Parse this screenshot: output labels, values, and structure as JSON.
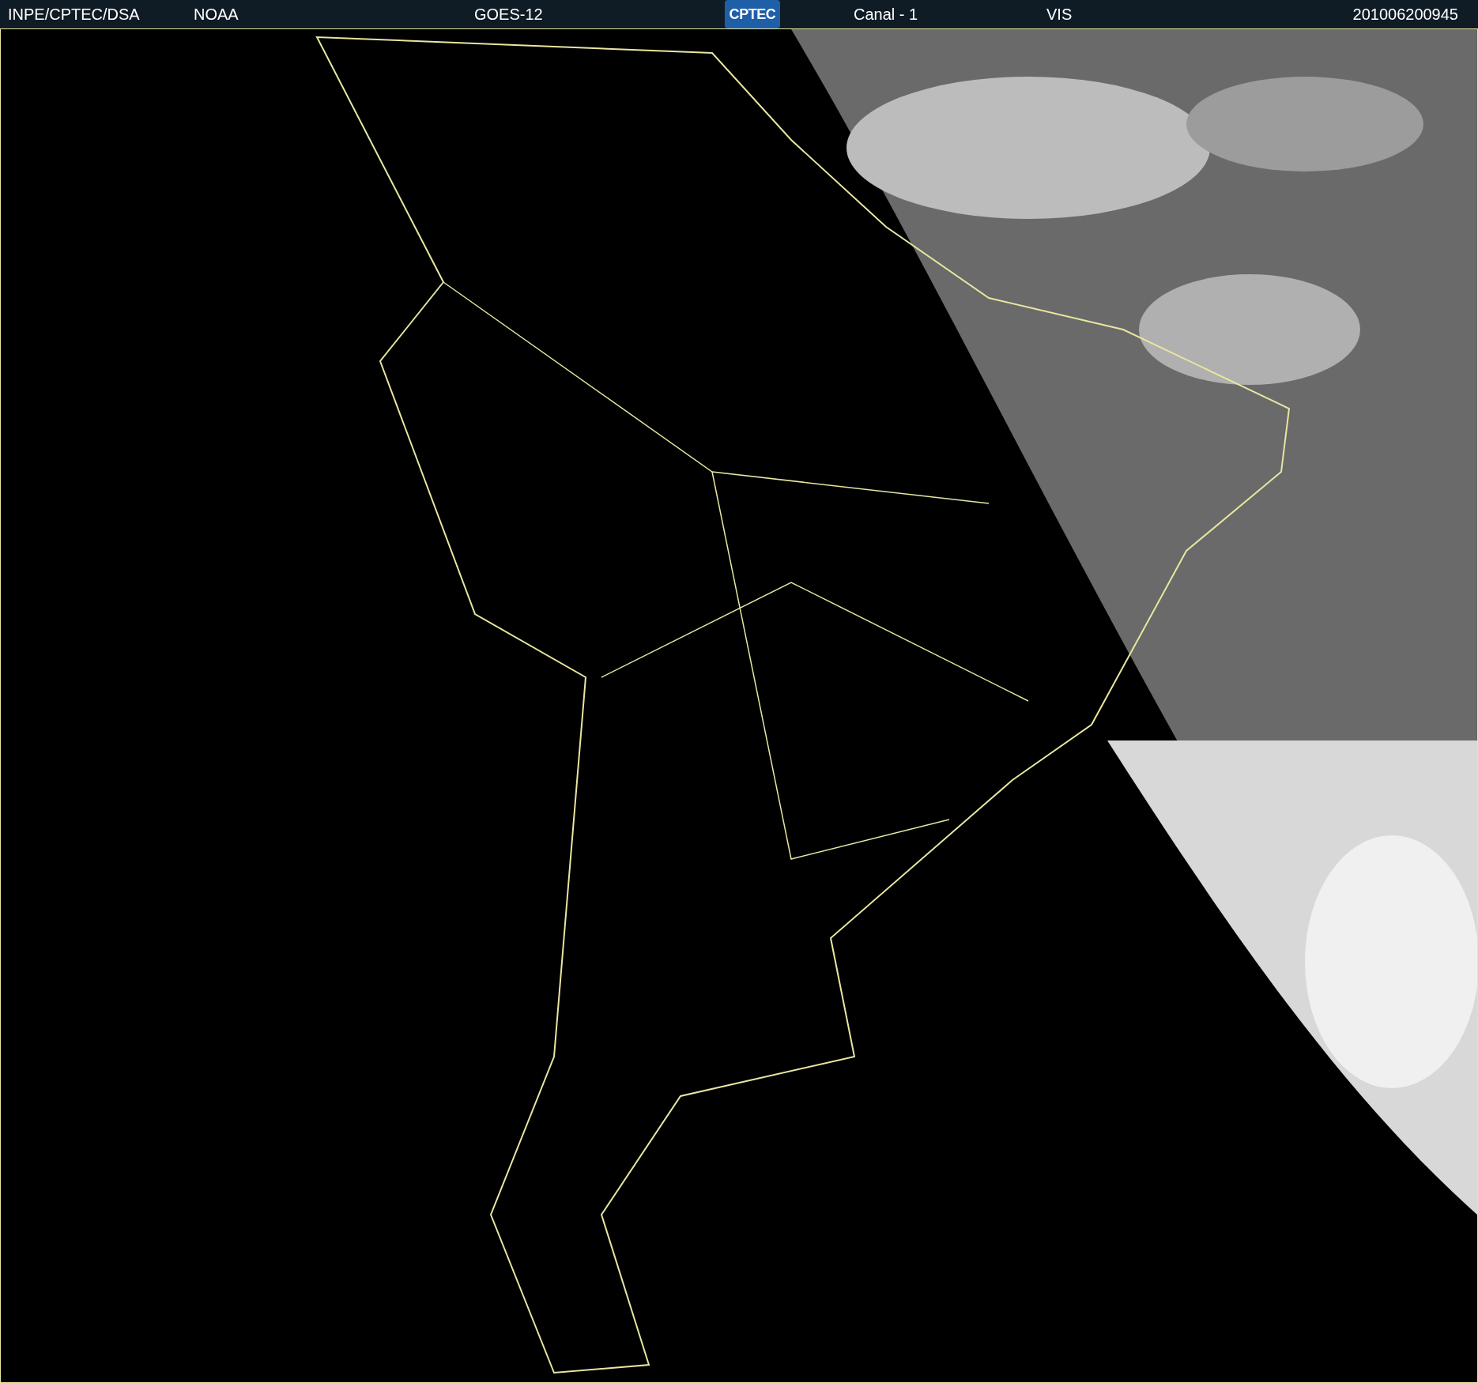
{
  "header": [
    {
      "kind": "text",
      "text": "INPE/CPTEC/DSA"
    },
    {
      "kind": "text",
      "text": "NOAA"
    },
    {
      "kind": "text",
      "text": "GOES-12"
    },
    {
      "kind": "logo",
      "text": "CPTEC"
    },
    {
      "kind": "text",
      "text": "Canal - 1"
    },
    {
      "kind": "text",
      "text": "VIS"
    },
    {
      "kind": "text",
      "text": "201006200945"
    }
  ]
}
